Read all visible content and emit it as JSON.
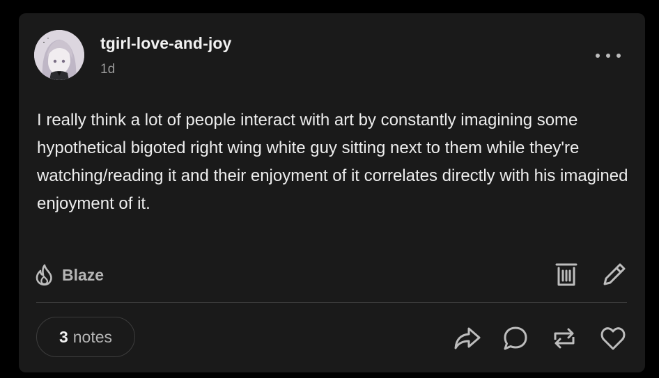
{
  "post": {
    "author": "tgirl-love-and-joy",
    "time_ago": "1d",
    "body": "I really think a lot of people interact with art by constantly imagining some hypothetical bigoted right wing white guy sitting next to them while they're watching/reading it and their enjoyment of it correlates directly with his imagined enjoyment of it."
  },
  "actions": {
    "blaze_label": "Blaze",
    "notes_count": "3",
    "notes_label": "notes"
  },
  "icons": {
    "more": "more-horizontal-icon",
    "blaze": "flame-icon",
    "delete": "trash-icon",
    "edit": "pencil-icon",
    "share": "share-arrow-icon",
    "reply": "speech-bubble-icon",
    "reblog": "reblog-icon",
    "like": "heart-icon"
  },
  "colors": {
    "background": "#000000",
    "card": "#1a1a1a",
    "text_primary": "#ededed",
    "text_secondary": "#9a9a9a",
    "icon": "#bdbdbd"
  }
}
